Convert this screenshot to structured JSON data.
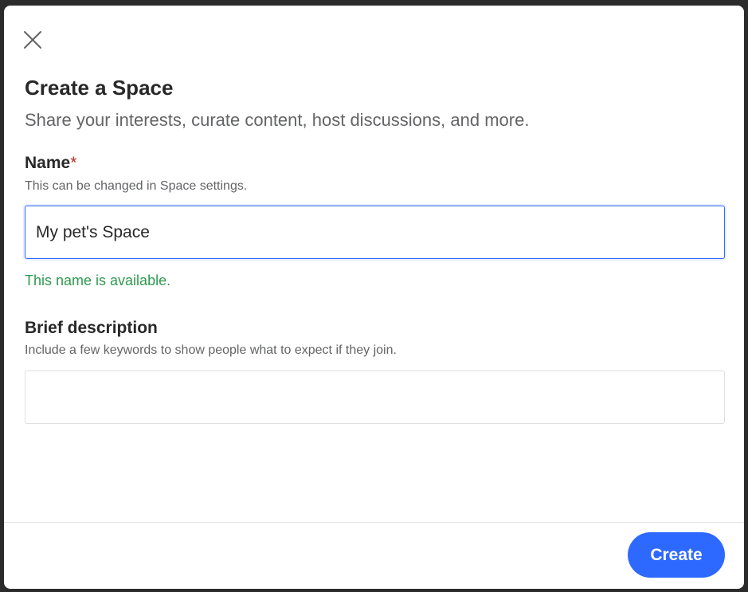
{
  "dialog": {
    "close_icon": "close-icon",
    "title": "Create a Space",
    "subtitle": "Share your interests, curate content, host discussions, and more."
  },
  "name_field": {
    "label": "Name",
    "required_marker": "*",
    "hint": "This can be changed in Space settings.",
    "value": "My pet's Space",
    "status": "This name is available."
  },
  "description_field": {
    "label": "Brief description",
    "hint": "Include a few keywords to show people what to expect if they join.",
    "value": ""
  },
  "footer": {
    "create_label": "Create"
  },
  "colors": {
    "accent": "#2e69ff",
    "success": "#2e9a4f",
    "required": "#b92b27",
    "text_primary": "#282829",
    "text_secondary": "#636466"
  }
}
